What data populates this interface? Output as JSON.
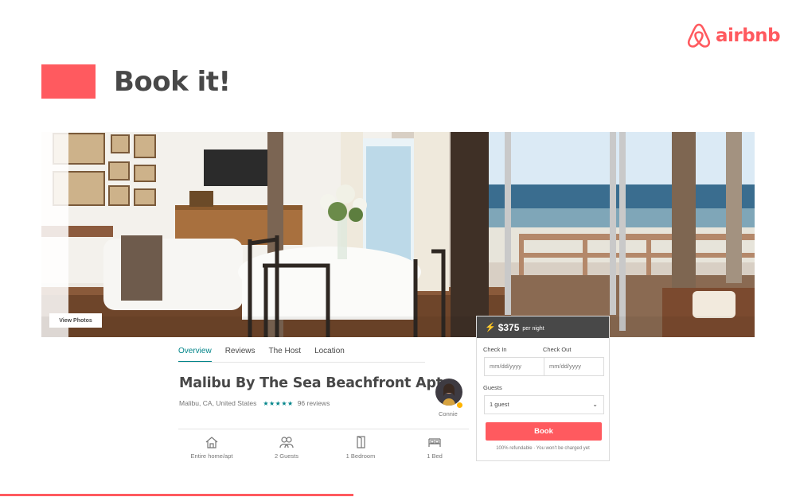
{
  "brand": {
    "name": "airbnb",
    "color": "#ff5a5f",
    "logo_icon": "airbnb-belo-icon"
  },
  "slide": {
    "title": "Book it!"
  },
  "hero": {
    "view_photos_label": "View Photos"
  },
  "tabs": [
    {
      "label": "Overview",
      "active": true
    },
    {
      "label": "Reviews",
      "active": false
    },
    {
      "label": "The Host",
      "active": false
    },
    {
      "label": "Location",
      "active": false
    }
  ],
  "listing": {
    "title": "Malibu By The Sea Beachfront Apt",
    "location": "Malibu, CA, United States",
    "stars": "★★★★★",
    "rating": 5,
    "reviews": "96 reviews",
    "host_name": "Connie"
  },
  "amenities": [
    {
      "icon": "home-icon",
      "label": "Entire home/apt"
    },
    {
      "icon": "guests-icon",
      "label": "2 Guests"
    },
    {
      "icon": "door-icon",
      "label": "1 Bedroom"
    },
    {
      "icon": "bed-icon",
      "label": "1 Bed"
    }
  ],
  "booking": {
    "price": "$375",
    "per_night": "per night",
    "check_in_label": "Check In",
    "check_out_label": "Check Out",
    "check_in_placeholder": "mm/dd/yyyy",
    "check_out_placeholder": "mm/dd/yyyy",
    "guests_label": "Guests",
    "guests_value": "1 guest",
    "book_label": "Book",
    "refund_note": "100% refundable · You won't be charged yet"
  },
  "colors": {
    "accent": "#ff5a5f",
    "teal": "#008489",
    "dark": "#484848",
    "gold": "#ffb400"
  }
}
